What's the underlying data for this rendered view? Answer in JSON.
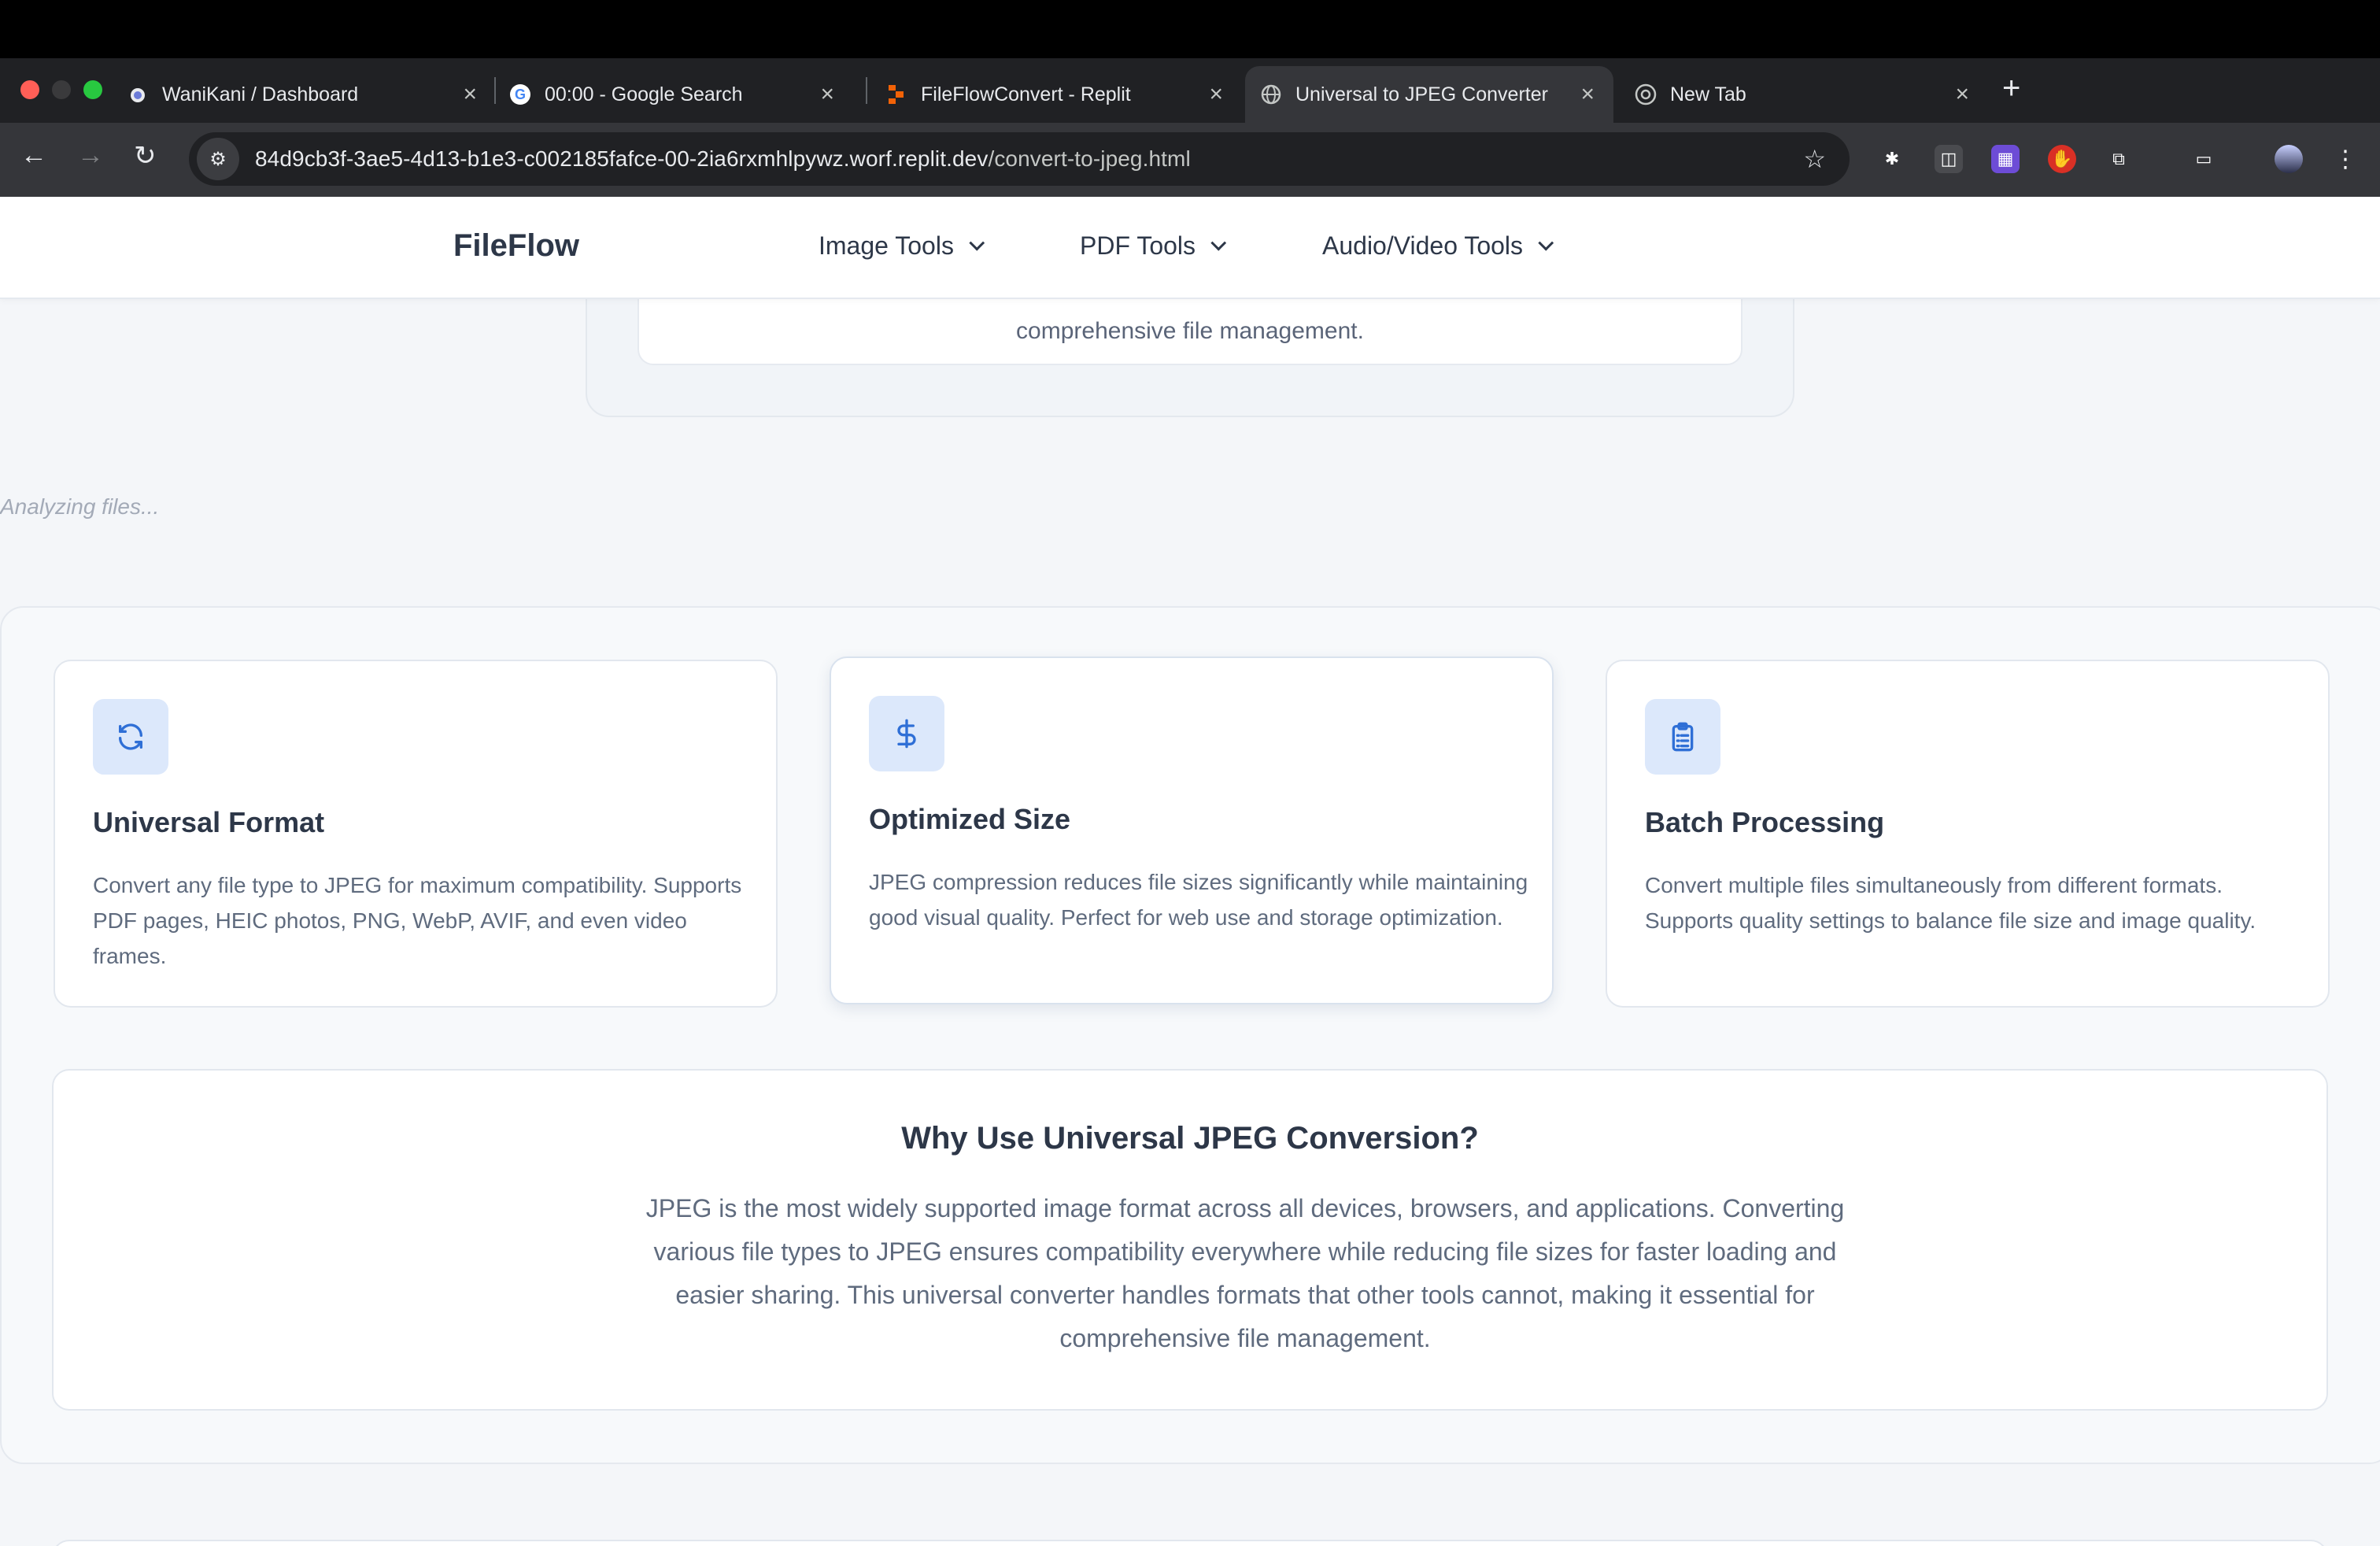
{
  "browser": {
    "tabs": [
      {
        "title": "WaniKani / Dashboard",
        "icon": "wanikani-icon",
        "active": false
      },
      {
        "title": "00:00 - Google Search",
        "icon": "google-icon",
        "active": false
      },
      {
        "title": "FileFlowConvert - Replit",
        "icon": "replit-icon",
        "active": false
      },
      {
        "title": "Universal to JPEG Converter",
        "icon": "globe-icon",
        "active": true
      },
      {
        "title": "New Tab",
        "icon": "chrome-icon",
        "active": false
      }
    ],
    "url_host": "84d9cb3f-3ae5-4d13-b1e3-c002185fafce-00-2ia6rxmhlpywz.worf.replit.dev",
    "url_path": "/convert-to-jpeg.html"
  },
  "header": {
    "logo": "FileFlow",
    "menus": [
      "Image Tools",
      "PDF Tools",
      "Audio/Video Tools"
    ]
  },
  "partial_card": {
    "text": "comprehensive file management."
  },
  "status": {
    "analyzing": "Analyzing files..."
  },
  "features": [
    {
      "icon": "refresh-icon",
      "title": "Universal Format",
      "description": "Convert any file type to JPEG for maximum compatibility. Supports PDF pages, HEIC photos, PNG, WebP, AVIF, and even video frames."
    },
    {
      "icon": "dollar-icon",
      "title": "Optimized Size",
      "description": "JPEG compression reduces file sizes significantly while maintaining good visual quality. Perfect for web use and storage optimization."
    },
    {
      "icon": "clipboard-icon",
      "title": "Batch Processing",
      "description": "Convert multiple files simultaneously from different formats. Supports quality settings to balance file size and image quality."
    }
  ],
  "why": {
    "title": "Why Use Universal JPEG Conversion?",
    "body": "JPEG is the most widely supported image format across all devices, browsers, and applications. Converting various file types to JPEG ensures compatibility everywhere while reducing file sizes for faster loading and easier sharing. This universal converter handles formats that other tools cannot, making it essential for comprehensive file management."
  },
  "colors": {
    "accent": "#2f6fd6",
    "icon_bg": "#dce8fb",
    "text_dark": "#2d3748",
    "text_muted": "#5f6b7e"
  }
}
